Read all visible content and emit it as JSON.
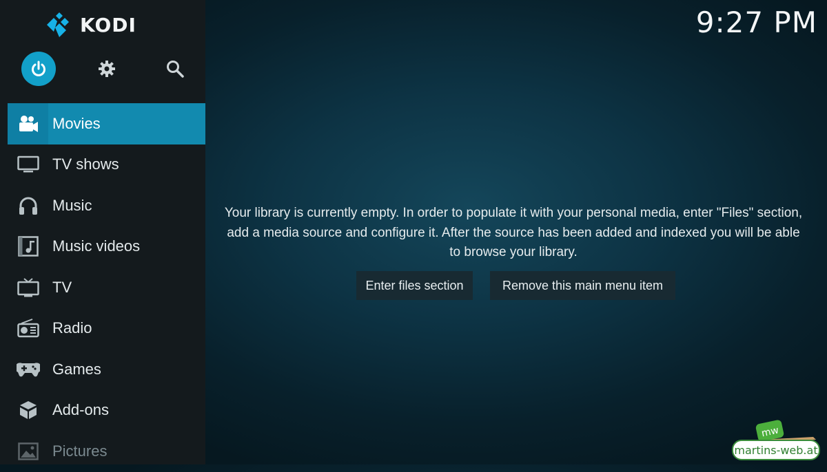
{
  "app": {
    "logo_text": "KODI"
  },
  "clock": "9:27 PM",
  "top_controls": [
    {
      "name": "power",
      "icon": "power-icon"
    },
    {
      "name": "settings",
      "icon": "gear-icon"
    },
    {
      "name": "search",
      "icon": "search-icon"
    }
  ],
  "menu": {
    "items": [
      {
        "label": "Movies",
        "icon": "movie-camera-icon",
        "active": true
      },
      {
        "label": "TV shows",
        "icon": "monitor-icon"
      },
      {
        "label": "Music",
        "icon": "headphones-icon"
      },
      {
        "label": "Music videos",
        "icon": "music-video-icon"
      },
      {
        "label": "TV",
        "icon": "tv-icon"
      },
      {
        "label": "Radio",
        "icon": "radio-icon"
      },
      {
        "label": "Games",
        "icon": "gamepad-icon"
      },
      {
        "label": "Add-ons",
        "icon": "addons-box-icon"
      },
      {
        "label": "Pictures",
        "icon": "picture-icon"
      }
    ]
  },
  "main": {
    "message": "Your library is currently empty. In order to populate it with your personal media, enter \"Files\" section, add a media source and configure it. After the source has been added and indexed you will be able to browse your library.",
    "enter_files_label": "Enter files section",
    "remove_item_label": "Remove this main menu item"
  },
  "watermark": {
    "text": "martins-web.at",
    "badge": "mw"
  },
  "colors": {
    "accent": "#128aaf",
    "power_button": "#12a0c9",
    "sidebar": "#141a1d",
    "background": "#0d3344"
  }
}
